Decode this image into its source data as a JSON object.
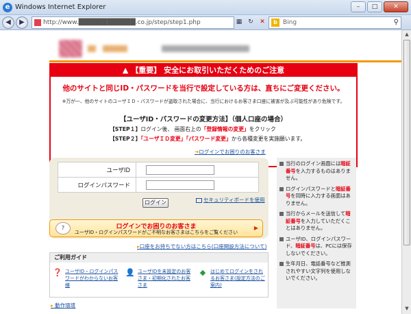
{
  "window": {
    "title": "Windows Internet Explorer",
    "address": "http://www.████████████.co.jp/step/step1.php",
    "search_placeholder": "Bing",
    "controls": [
      "minimize",
      "maximize",
      "close"
    ]
  },
  "alert": {
    "header": "【重要】 安全にお取引いただくためのご注意",
    "main": "他のサイトと同じID・パスワードを当行で設定している方は、直ちにご変更ください。",
    "sub": "※万が一、他のサイトのユーザＩＤ・パスワードが盗取された場合に、当行におけるお客さま口座に被害が及ぶ可能性があり危険です。",
    "method_title": "【ユーザID・パスワードの変更方法】（個人口座の場合）",
    "step1_label": "【STEP１】",
    "step1_text_a": "ログイン後、 画面右上の",
    "step1_text_red": "「登録情報の変更」",
    "step1_text_b": "をクリック",
    "step2_label": "【STEP２】",
    "step2_text_red": "「ユーザＩＤ変更」「パスワード変更」",
    "step2_text_b": "から各種変更を実施願います。"
  },
  "links": {
    "trouble_top": "ログインでお困りのお客さま",
    "security_keyboard": "セキュリティボードを使用",
    "pending": "口座をお持ちでない方はこちら(口座開設方法について)",
    "environment": "動作環境"
  },
  "login": {
    "user_id_label": "ユーザID",
    "password_label": "ログインパスワード",
    "user_id_value": "",
    "password_value": "",
    "button": "ログイン"
  },
  "trouble_banner": {
    "title": "ログインでお困りのお客さま",
    "subtitle": "ユーザID・ログインパスワードがご不明なお客さまはこちらをご覧ください"
  },
  "guide": {
    "title": "ご利用ガイド",
    "items": [
      {
        "icon": "question-person-icon",
        "text": "ユーザID・ログインパスワードがわからないお客様"
      },
      {
        "icon": "person-icon",
        "text": "ユーザIDを未設定のお客さま・初期化されたお客さま"
      },
      {
        "icon": "beginner-mark-icon",
        "text": "はじめてログインをされるお客さま(設定方法のご案内)"
      }
    ]
  },
  "notice": [
    {
      "pre": "当行のログイン画面には",
      "red": "暗証番号",
      "post": "を入力するものはありません。"
    },
    {
      "pre": "ログインパスワードと",
      "red": "暗証番号",
      "post": "を同時に入力する画面はありません。"
    },
    {
      "pre": "当行からメールを送信して",
      "red": "暗証番号",
      "post": "を入力していただくことはありません。"
    },
    {
      "pre": "ユーザID、ログインパスワード、",
      "red": "暗証番号",
      "post": "は、PCには保存しないでください。"
    },
    {
      "pre": "生年月日、電話番号など推測されやすい文字列を使用しないでください。",
      "red": "",
      "post": ""
    }
  ],
  "colors": {
    "alert_red": "#e60012",
    "brand_orange": "#f39800",
    "link_blue": "#1a4fa0"
  }
}
